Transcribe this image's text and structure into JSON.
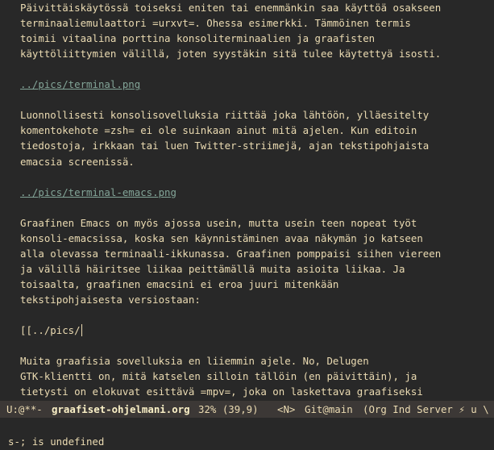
{
  "buffer": {
    "lines": [
      {
        "text": "Päivittäiskäytössä toiseksi eniten tai enemmänkin saa käyttöä osakseen",
        "kind": "text"
      },
      {
        "text": "terminaaliemulaattori =urxvt=. Ohessa esimerkki. Tämmöinen termis",
        "kind": "text"
      },
      {
        "text": "toimii vitaalina porttina konsoliterminaalien ja graafisten",
        "kind": "text"
      },
      {
        "text": "käyttöliittymien välillä, joten syystäkin sitä tulee käytettyä isosti.",
        "kind": "text"
      },
      {
        "text": "",
        "kind": "blank"
      },
      {
        "text": "../pics/terminal.png",
        "kind": "link"
      },
      {
        "text": "",
        "kind": "blank"
      },
      {
        "text": "Luonnollisesti konsolisovelluksia riittää joka lähtöön, ylläesitelty",
        "kind": "text"
      },
      {
        "text": "komentokehote =zsh= ei ole suinkaan ainut mitä ajelen. Kun editoin",
        "kind": "text"
      },
      {
        "text": "tiedostoja, irkkaan tai luen Twitter-striimejä, ajan tekstipohjaista",
        "kind": "text"
      },
      {
        "text": "emacsia screenissä.",
        "kind": "text"
      },
      {
        "text": "",
        "kind": "blank"
      },
      {
        "text": "../pics/terminal-emacs.png",
        "kind": "link"
      },
      {
        "text": "",
        "kind": "blank"
      },
      {
        "text": "Graafinen Emacs on myös ajossa usein, mutta usein teen nopeat työt",
        "kind": "text"
      },
      {
        "text": "konsoli-emacsissa, koska sen käynnistäminen avaa näkymän jo katseen",
        "kind": "text"
      },
      {
        "text": "alla olevassa terminaali-ikkunassa. Graafinen pomppaisi siihen viereen",
        "kind": "text"
      },
      {
        "text": "ja välillä häiritsee liikaa peittämällä muita asioita liikaa. Ja",
        "kind": "text"
      },
      {
        "text": "toisaalta, graafinen emacsini ei eroa juuri mitenkään",
        "kind": "text"
      },
      {
        "text": "tekstipohjaisesta versiostaan:",
        "kind": "text"
      },
      {
        "text": "",
        "kind": "blank"
      },
      {
        "text": "[[../pics/",
        "kind": "cursor"
      },
      {
        "text": "",
        "kind": "blank"
      },
      {
        "text": "Muita graafisia sovelluksia en liiemmin ajele. No, Delugen",
        "kind": "text"
      },
      {
        "text": "GTK-klientti on, mitä katselen silloin tällöin (en päivittäin), ja",
        "kind": "text"
      },
      {
        "text": "tietysti on elokuvat esittävä =mpv=, joka on laskettava graafiseksi",
        "kind": "text"
      }
    ]
  },
  "modeline": {
    "status": "U:@**-",
    "buffer_name": "graafiset-ohjelmani.org",
    "position": "32% (39,9)",
    "evil_state": "<N>",
    "vcs": "Git@main",
    "modes": "(Org Ind Server ⚡ u \\ α"
  },
  "echo_area": {
    "message": "s-; is undefined"
  },
  "colors": {
    "background": "#282828",
    "foreground": "#ebdbb2",
    "link": "#83a598",
    "modeline_bg": "#3c3836"
  }
}
